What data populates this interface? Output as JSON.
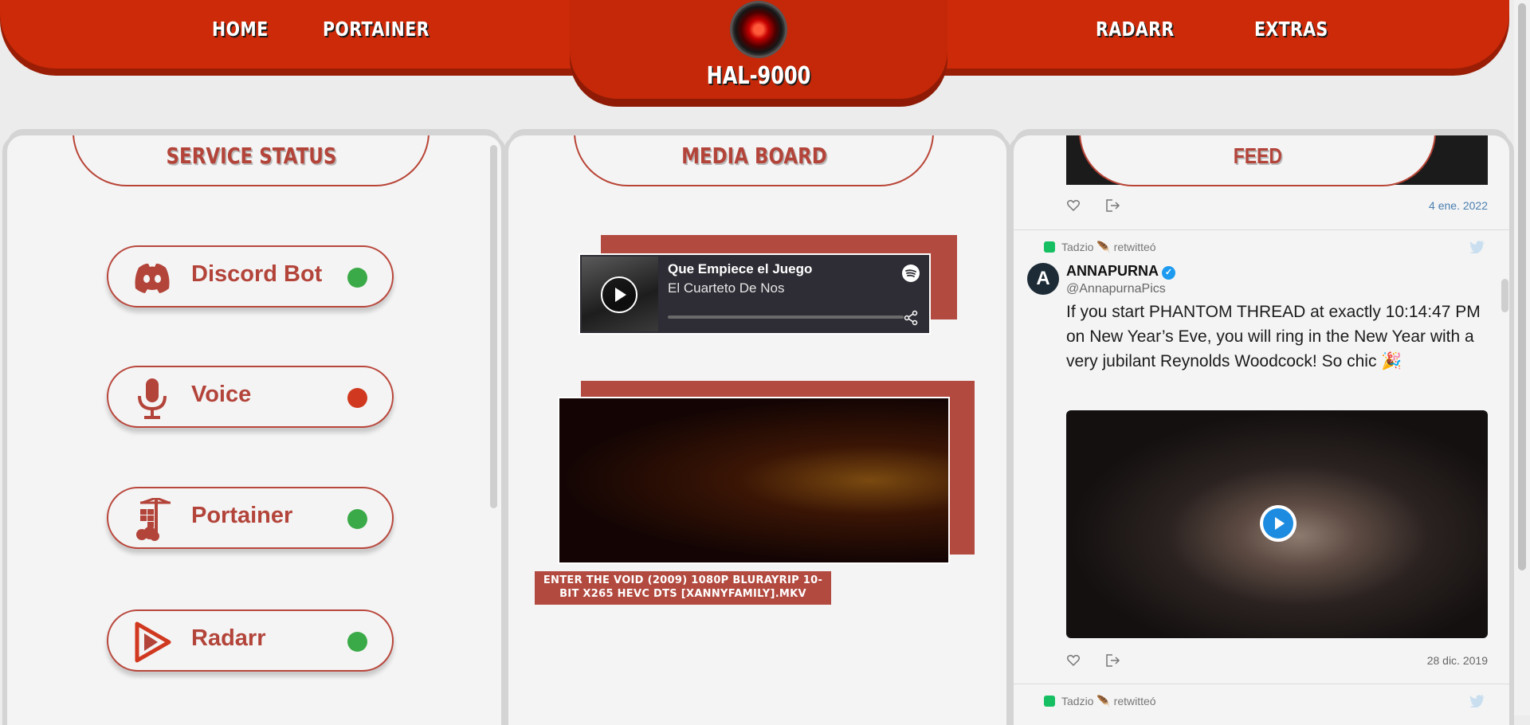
{
  "nav": {
    "home": "HOME",
    "portainer": "PORTAINER",
    "radarr": "RADARR",
    "extras": "EXTRAS",
    "brand": "HAL-9000"
  },
  "panels": {
    "service_status": "SERVICE STATUS",
    "media_board": "MEDIA BOARD",
    "feed": "FEED"
  },
  "services": [
    {
      "label": "Discord Bot",
      "status": "online",
      "status_color": "#3aaa48",
      "icon": "discord-icon"
    },
    {
      "label": "Voice",
      "status": "offline",
      "status_color": "#d0391f",
      "icon": "microphone-icon"
    },
    {
      "label": "Portainer",
      "status": "online",
      "status_color": "#3aaa48",
      "icon": "portainer-icon"
    },
    {
      "label": "Radarr",
      "status": "online",
      "status_color": "#3aaa48",
      "icon": "radarr-icon"
    }
  ],
  "spotify": {
    "title": "Que Empiece el Juego",
    "artist": "El Cuarteto De Nos"
  },
  "video": {
    "caption": "ENTER THE VOID (2009) 1080P BLURAYRIP 10-BIT X265 HEVC DTS [XANNYFAMILY].MKV"
  },
  "feed": {
    "first_tweet_date": "4 ene. 2022",
    "retweet_text": "Tadzio 🪶 retwitteó",
    "second_tweet": {
      "avatar_letter": "A",
      "name": "ANNAPURNA",
      "handle": "@AnnapurnaPics",
      "text": "If you start PHANTOM THREAD at exactly 10:14:47 PM on New Year’s Eve, you will ring in the New Year with a very jubilant Reynolds Woodcock! So chic 🎉",
      "date": "28 dic. 2019"
    },
    "third_retweet_text": "Tadzio 🪶 retwitteó"
  },
  "colors": {
    "header_red": "#cc2a08",
    "accent_red": "#b3443a",
    "online_green": "#3aaa48",
    "offline_red": "#d0391f"
  }
}
